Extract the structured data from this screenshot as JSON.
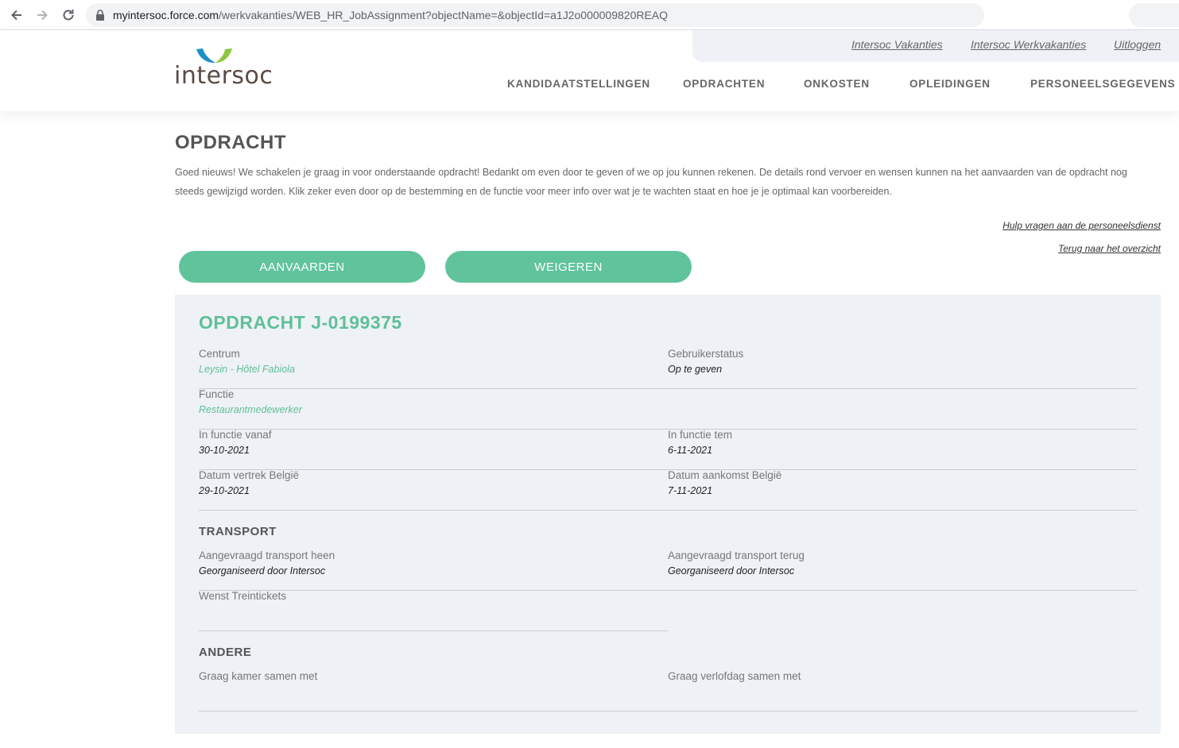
{
  "browser": {
    "url_host": "myintersoc.force.com",
    "url_path": "/werkvakanties/WEB_HR_JobAssignment?objectName=&objectId=a1J2o000009820REAQ"
  },
  "header": {
    "logo_text": "intersoc",
    "utility_links": [
      "Intersoc Vakanties",
      "Intersoc Werkvakanties",
      "Uitloggen"
    ],
    "nav": [
      "KANDIDAATSTELLINGEN",
      "OPDRACHTEN",
      "ONKOSTEN",
      "OPLEIDINGEN",
      "PERSONEELSGEGEVENS"
    ]
  },
  "page": {
    "title": "OPDRACHT",
    "intro_line1": "Goed nieuws! We schakelen je graag in voor onderstaande opdracht! Bedankt om even door te geven of we op jou kunnen rekenen. De details rond vervoer en wensen kunnen na het aanvaarden van de opdracht nog",
    "intro_line2": "steeds gewijzigd worden. Klik zeker even door op de bestemming en de functie voor meer info over wat je te wachten staat en hoe je je optimaal kan voorbereiden.",
    "help_link": "Hulp vragen aan de personeelsdienst",
    "back_link": "Terug naar het overzicht",
    "accept_label": "AANVAARDEN",
    "decline_label": "WEIGEREN"
  },
  "assignment": {
    "title": "OPDRACHT J-0199375",
    "centrum_label": "Centrum",
    "centrum_value": "Leysin - Hôtel Fabiola",
    "status_label": "Gebruikerstatus",
    "status_value": "Op te geven",
    "functie_label": "Functie",
    "functie_value": "Restaurantmedewerker",
    "vanaf_label": "In functie vanaf",
    "vanaf_value": "30-10-2021",
    "tem_label": "In functie tem",
    "tem_value": "6-11-2021",
    "vertrek_label": "Datum vertrek België",
    "vertrek_value": "29-10-2021",
    "aankomst_label": "Datum aankomst België",
    "aankomst_value": "7-11-2021",
    "transport_heading": "TRANSPORT",
    "heen_label": "Aangevraagd transport heen",
    "heen_value": "Georganiseerd door Intersoc",
    "terug_label": "Aangevraagd transport terug",
    "terug_value": "Georganiseerd door Intersoc",
    "trein_label": "Wenst Treintickets",
    "andere_heading": "ANDERE",
    "kamer_label": "Graag kamer samen met",
    "verlof_label": "Graag verlofdag samen met"
  },
  "colors": {
    "accent": "#60c39c",
    "panel": "#eef1f5",
    "logo_blue": "#1c8fc9",
    "logo_green": "#8dc63f"
  }
}
